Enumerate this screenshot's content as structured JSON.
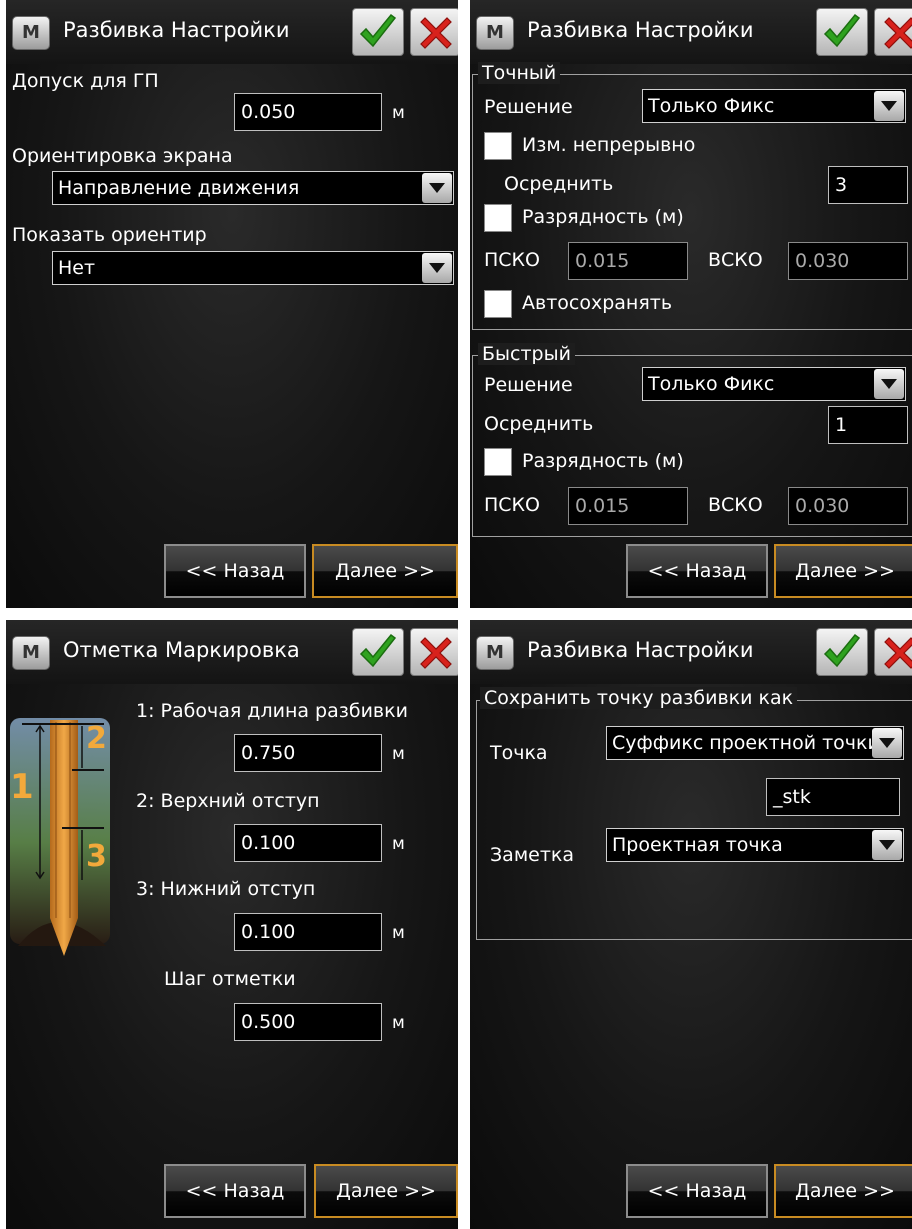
{
  "common": {
    "menu_icon_label": "M",
    "back_label": "<< Назад",
    "next_label": "Далее >>",
    "ok_icon": "checkmark-icon",
    "cancel_icon": "close-icon"
  },
  "panel1": {
    "title": "Разбивка Настройки",
    "tolerance_label": "Допуск для ГП",
    "tolerance_value": "0.050",
    "tolerance_unit": "м",
    "orientation_label": "Ориентировка экрана",
    "orientation_value": "Направление движения",
    "landmark_label": "Показать ориентир",
    "landmark_value": "Нет"
  },
  "panel2": {
    "title": "Разбивка Настройки",
    "precise": {
      "group_label": "Точный",
      "solution_label": "Решение",
      "solution_value": "Только Фикс",
      "continuous_label": "Изм. непрерывно",
      "average_label": "Осреднить",
      "average_value": "3",
      "precision_label": "Разрядность (м)",
      "hrms_label": "ПСКО",
      "hrms_value": "0.015",
      "vrms_label": "ВСКО",
      "vrms_value": "0.030",
      "autosave_label": "Автосохранять"
    },
    "fast": {
      "group_label": "Быстрый",
      "solution_label": "Решение",
      "solution_value": "Только Фикс",
      "average_label": "Осреднить",
      "average_value": "1",
      "precision_label": "Разрядность (м)",
      "hrms_label": "ПСКО",
      "hrms_value": "0.015",
      "vrms_label": "ВСКО",
      "vrms_value": "0.030"
    }
  },
  "panel3": {
    "title": "Отметка Маркировка",
    "marker_numbers": [
      "1",
      "2",
      "3"
    ],
    "work_length_label": "1: Рабочая длина разбивки",
    "work_length_value": "0.750",
    "top_offset_label": "2: Верхний отступ",
    "top_offset_value": "0.100",
    "bottom_offset_label": "3: Нижний отступ",
    "bottom_offset_value": "0.100",
    "step_label": "Шаг отметки",
    "step_value": "0.500",
    "unit": "м"
  },
  "panel4": {
    "title": "Разбивка Настройки",
    "group_label": "Сохранить точку разбивки как",
    "point_label": "Точка",
    "point_value": "Суффикс проектной точки",
    "suffix_value": "_stk",
    "note_label": "Заметка",
    "note_value": "Проектная точка"
  }
}
